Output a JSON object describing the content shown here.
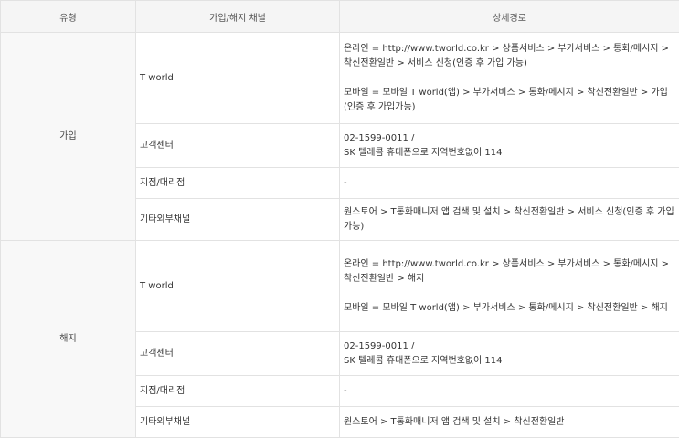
{
  "header": {
    "type": "유형",
    "channel": "가입/해지 채널",
    "detail": "상세경로"
  },
  "subscribe": {
    "type": "가입",
    "rows": [
      {
        "channel": "T world",
        "online": "온라인 = http://www.tworld.co.kr > 상품서비스 > 부가서비스 > 통화/메시지 > 착신전환일반 > 서비스 신청(인증 후 가입 가능)",
        "mobile": "모바일 = 모바일 T world(앱) > 부가서비스 > 통화/메시지 > 착신전환일반 > 가입(인증 후 가입가능)"
      },
      {
        "channel": "고객센터",
        "line1": "02-1599-0011 /",
        "line2": "SK 텔레콤 휴대폰으로 지역번호없이 114"
      },
      {
        "channel": "지점/대리점",
        "detail": "-"
      },
      {
        "channel": "기타외부채널",
        "detail": "원스토어 > T통화매니저 앱 검색 및 설치 > 착신전환일반 > 서비스 신청(인증 후 가입가능)"
      }
    ]
  },
  "cancel": {
    "type": "해지",
    "rows": [
      {
        "channel": "T world",
        "online": "온라인 = http://www.tworld.co.kr > 상품서비스 > 부가서비스 > 통화/메시지 > 착신전환일반 > 해지",
        "mobile": "모바일 = 모바일 T world(앱) > 부가서비스 > 통화/메시지 > 착신전환일반 > 해지"
      },
      {
        "channel": "고객센터",
        "line1": "02-1599-0011 /",
        "line2": "SK 텔레콤 휴대폰으로 지역번호없이 114"
      },
      {
        "channel": "지점/대리점",
        "detail": "-"
      },
      {
        "channel": "기타외부채널",
        "detail": "원스토어 > T통화매니저 앱 검색 및 설치 > 착신전환일반"
      }
    ]
  }
}
